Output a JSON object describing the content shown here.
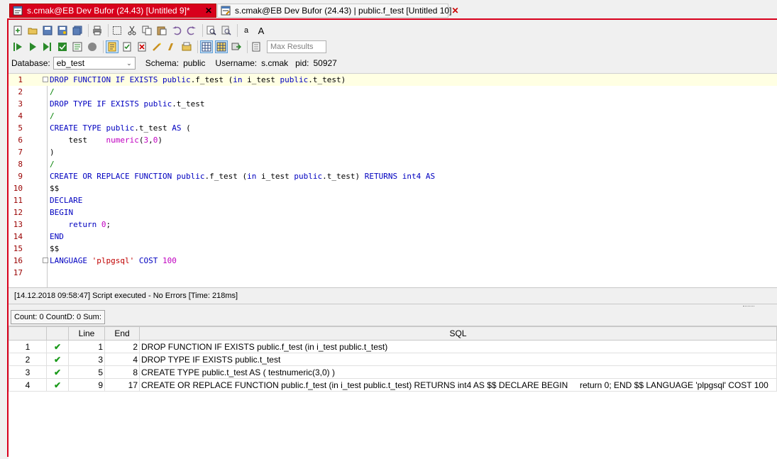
{
  "tabs": [
    {
      "label": "s.cmak@EB Dev Bufor (24.43) [Untitled 9]*",
      "active": true
    },
    {
      "label": "s.cmak@EB Dev Bufor (24.43) | public.f_test [Untitled 10]",
      "active": false
    }
  ],
  "toolbar": {
    "max_results_placeholder": "Max Results",
    "font_smaller_label": "a",
    "font_larger_label": "A"
  },
  "connection": {
    "database_label": "Database:",
    "database_value": "eb_test",
    "schema_label": "Schema:",
    "schema_value": "public",
    "username_label": "Username:",
    "username_value": "s.cmak",
    "pid_label": "pid:",
    "pid_value": "50927"
  },
  "editor": {
    "line_numbers": [
      "1",
      "2",
      "3",
      "4",
      "5",
      "6",
      "7",
      "8",
      "9",
      "10",
      "11",
      "12",
      "13",
      "14",
      "15",
      "16",
      "17"
    ]
  },
  "status": {
    "message": "[14.12.2018 09:58:47] Script executed - No Errors [Time: 218ms]"
  },
  "counts": {
    "text": "Count: 0  CountD: 0  Sum:"
  },
  "results": {
    "columns": [
      "",
      "",
      "Line",
      "End",
      "SQL"
    ],
    "rows": [
      {
        "num": "1",
        "line": "1",
        "end": "2",
        "sql": "DROP FUNCTION IF EXISTS public.f_test (in i_test public.t_test)"
      },
      {
        "num": "2",
        "line": "3",
        "end": "4",
        "sql": "DROP TYPE IF EXISTS public.t_test"
      },
      {
        "num": "3",
        "line": "5",
        "end": "8",
        "sql": "CREATE TYPE public.t_test AS (  testnumeric(3,0) )"
      },
      {
        "num": "4",
        "line": "9",
        "end": "17",
        "sql": "CREATE OR REPLACE FUNCTION public.f_test (in i_test public.t_test) RETURNS int4 AS $$ DECLARE BEGIN     return 0; END $$ LANGUAGE 'plpgsql' COST 100"
      }
    ]
  },
  "colors": {
    "accent": "#d8001c",
    "keyword": "#0000c0",
    "number": "#c000c0",
    "string": "#c00000",
    "separator": "#008000",
    "line_number": "#990000",
    "check": "#1a9a1a"
  }
}
